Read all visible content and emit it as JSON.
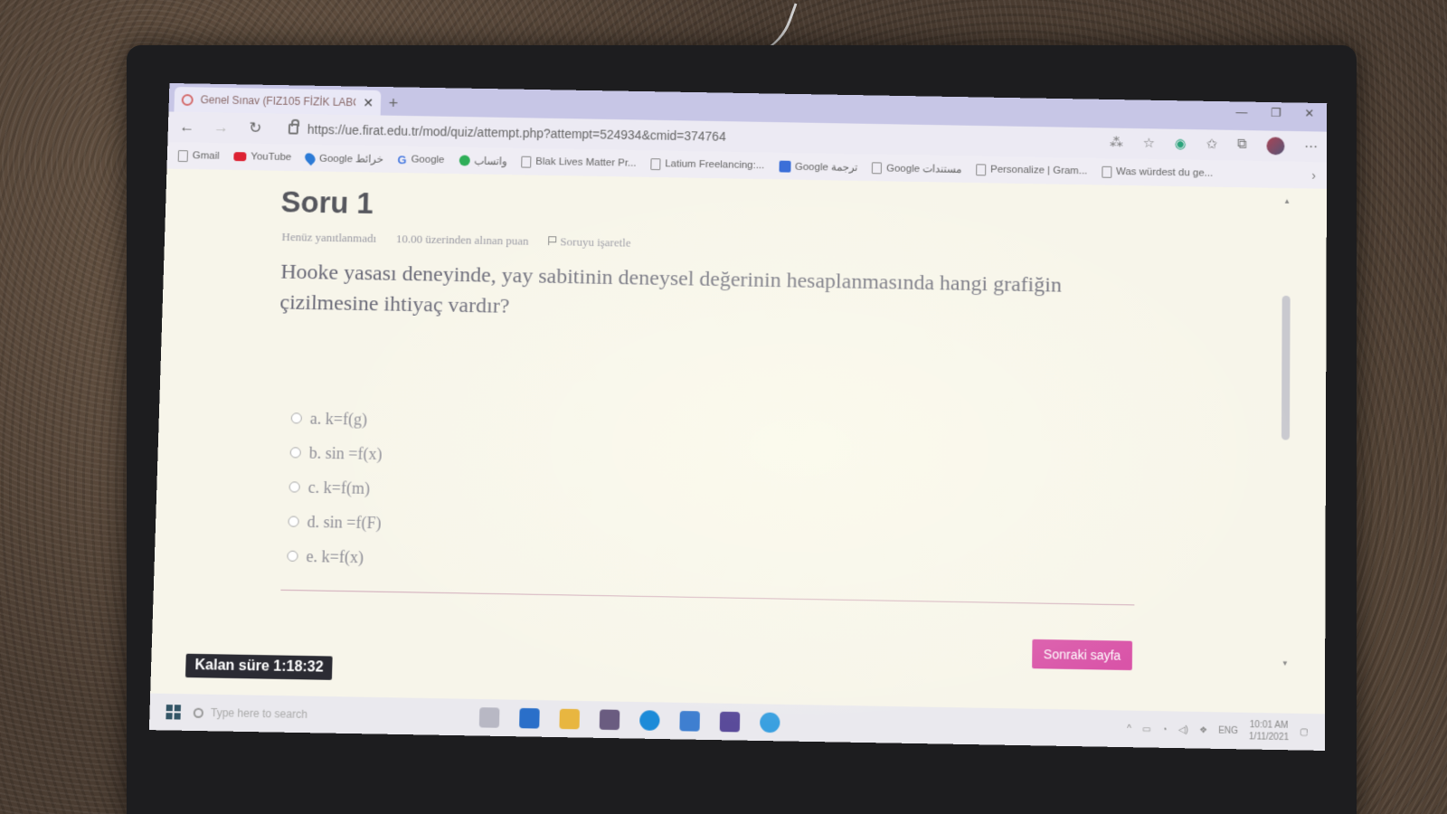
{
  "browser": {
    "tab_title": "Genel Sınav (FIZ105 FİZİK LABO",
    "tab_close": "✕",
    "new_tab": "+",
    "url": "https://ue.firat.edu.tr/mod/quiz/attempt.php?attempt=524934&cmid=374764",
    "window": {
      "minimize": "—",
      "restore": "❐",
      "close": "✕"
    }
  },
  "bookmarks": [
    {
      "label": "Gmail",
      "icon": "page-icon"
    },
    {
      "label": "YouTube",
      "icon": "youtube-icon"
    },
    {
      "label": "Google خرائط",
      "icon": "maps-icon"
    },
    {
      "label": "Google",
      "icon": "google-icon"
    },
    {
      "label": "واتساب",
      "icon": "whatsapp-icon"
    },
    {
      "label": "Blak Lives Matter Pr...",
      "icon": "page-icon"
    },
    {
      "label": "Latium Freelancing:...",
      "icon": "page-icon"
    },
    {
      "label": "Google ترجمة",
      "icon": "translate-icon"
    },
    {
      "label": "Google مستندات",
      "icon": "page-icon"
    },
    {
      "label": "Personalize | Gram...",
      "icon": "page-icon"
    },
    {
      "label": "Was würdest du ge...",
      "icon": "page-icon"
    }
  ],
  "quiz": {
    "title": "Soru 1",
    "status": "Henüz yanıtlanmadı",
    "points": "10.00 üzerinden alınan puan",
    "flag_label": "Soruyu işaretle",
    "question": "Hooke yasası deneyinde, yay sabitinin deneysel değerinin hesaplanmasında hangi grafiğin çizilmesine ihtiyaç vardır?",
    "answers": [
      "a. k=f(g)",
      "b. sin =f(x)",
      "c. k=f(m)",
      "d. sin =f(F)",
      "e. k=f(x)"
    ],
    "next_button": "Sonraki sayfa",
    "timer": "Kalan süre 1:18:32"
  },
  "taskbar": {
    "search_placeholder": "Type here to search",
    "language": "ENG",
    "time": "10:01 AM",
    "date": "1/11/2021"
  },
  "colors": {
    "accent": "#d954a8",
    "timer_bg": "#2b2b33"
  }
}
